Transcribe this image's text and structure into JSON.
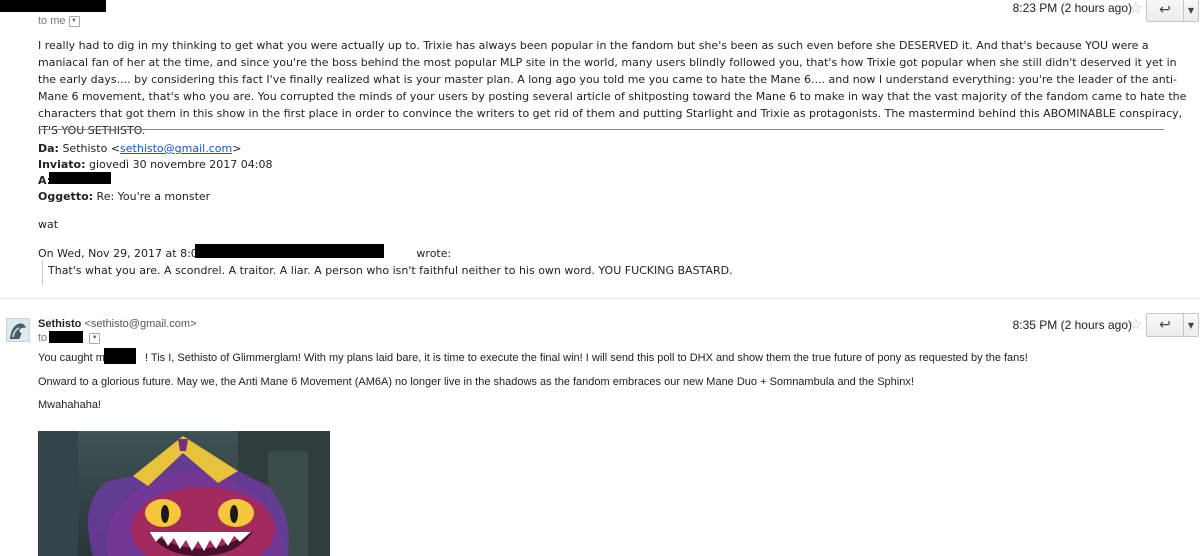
{
  "message1": {
    "to_label": "to me",
    "time": "8:23 PM (2 hours ago)",
    "body": "I really had to dig in my thinking to get what you were actually up to. Trixie has always been popular in the fandom but she's been as such even before she DESERVED it. And that's because YOU were a maniacal fan of her at the time, and since you're the boss behind the most popular MLP site in the world, many users blindly followed you, that's how Trixie got popular when she still didn't deserved it yet in the early days.... by considering this fact I've finally realized what is your master plan. A long ago you told me you came to hate the Mane 6.... and now I understand everything: you're the leader of the anti-Mane 6 movement, that's who you are. You corrupted the minds of your users by posting several article of shitposting toward the Mane 6 to make in way that the vast majority of the fandom came to hate the characters that got them in this show in the first place in order to convince the writers to get rid of them and putting Starlight and Trixie as protagonists. The mastermind behind this ABOMINABLE conspiracy, IT'S YOU SETHISTO.",
    "quoted": {
      "da_label": "Da:",
      "da_name": "Sethisto <",
      "da_email": "sethisto@gmail.com",
      "da_close": ">",
      "inviato_label": "Inviato:",
      "inviato_value": "giovedì 30 novembre 2017 04:08",
      "a_label": "A:",
      "oggetto_label": "Oggetto:",
      "oggetto_value": "Re: You're a monster",
      "reply": "wat",
      "on_prefix": "On Wed, Nov 29, 2017 at 8:04 PM",
      "on_suffix": "wrote:",
      "blockquote": "That's what you are. A scondrel. A traitor. A liar. A person who isn't faithful neither to his own word. YOU FUCKING BASTARD."
    }
  },
  "message2": {
    "sender_name": "Sethisto",
    "sender_email": "<sethisto@gmail.com>",
    "to_label": "to",
    "time": "8:35 PM (2 hours ago)",
    "line1_a": "You caught me",
    "line1_b": "! Tis I, Sethisto of Glimmerglam! With my plans laid bare, it is time to execute the final win! I will send this poll to DHX and show them the true future of pony as requested by the fans!",
    "line2": "Onward to a glorious future. May we, the Anti Mane 6 Movement (AM6A) no longer live in the shadows as the fandom embraces our new Mane Duo + Somnambula and the Sphinx!",
    "line3": "Mwahahaha!"
  },
  "icons": {
    "star": "star-icon",
    "reply": "reply-arrow-icon",
    "more": "dropdown-triangle-icon",
    "expand": "expand-caret-icon",
    "avatar": "sethisto-avatar"
  },
  "colors": {
    "link": "#1155cc",
    "redaction": "#000000",
    "divider": "#e5e5e5"
  }
}
